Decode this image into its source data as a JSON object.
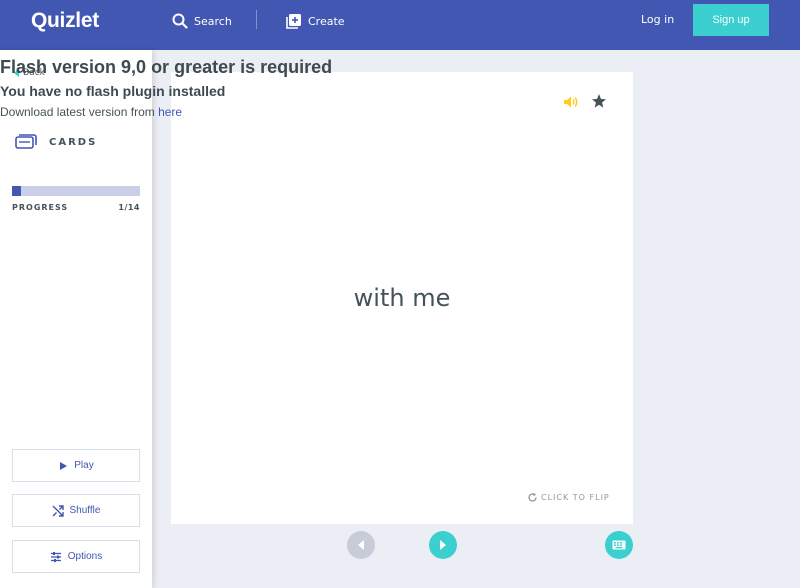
{
  "header": {
    "logo": "Quizlet",
    "search_label": "Search",
    "create_label": "Create",
    "login_label": "Log in",
    "signup_label": "Sign up"
  },
  "flash_notice": {
    "title": "Flash version 9,0 or greater is required",
    "subtitle": "You have no flash plugin installed",
    "download_text": "Download latest version from ",
    "download_link": "here"
  },
  "sidebar": {
    "back_label": "Back",
    "mode_title": "CARDS",
    "progress_label": "PROGRESS",
    "progress_count": "1/14",
    "progress_fraction": 0.071,
    "play_label": "Play",
    "shuffle_label": "Shuffle",
    "options_label": "Options"
  },
  "card": {
    "term": "with me",
    "flip_label": "CLICK TO FLIP"
  },
  "colors": {
    "brand": "#4257b2",
    "accent": "#3ccfcf",
    "audio": "#ffcd1f",
    "background": "#eceef5"
  },
  "icons": [
    "search-icon",
    "create-icon",
    "back-arrow-icon",
    "cards-icon",
    "play-icon",
    "shuffle-icon",
    "options-icon",
    "audio-icon",
    "star-icon",
    "flip-icon",
    "prev-icon",
    "next-icon",
    "keyboard-icon"
  ]
}
